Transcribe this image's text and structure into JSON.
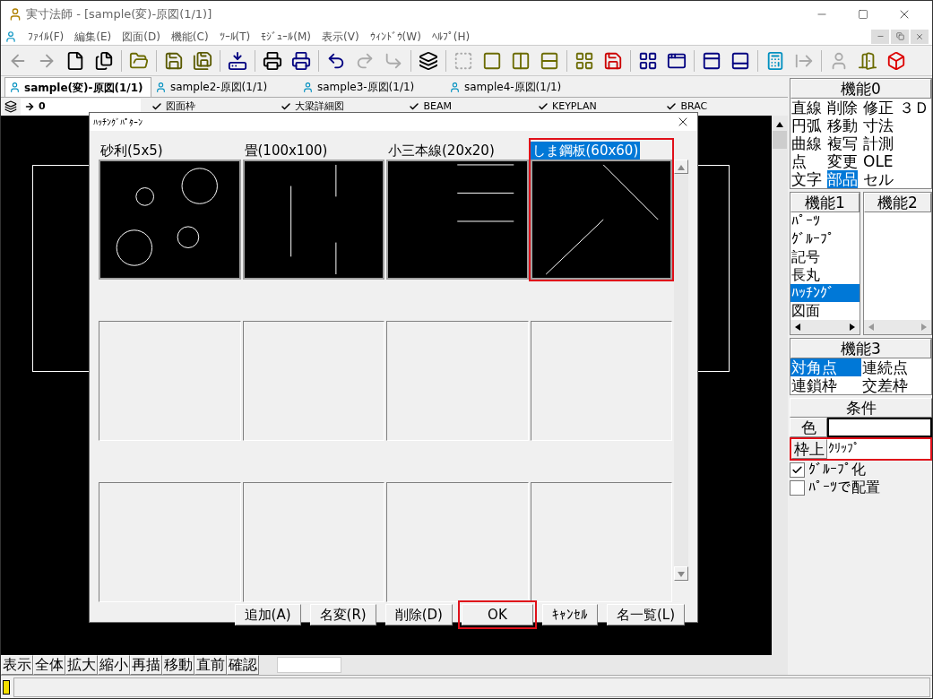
{
  "window": {
    "title": "実寸法師 - [sample(変)-原図(1/1)]"
  },
  "menu": [
    "ﾌｧｲﾙ(F)",
    "編集(E)",
    "図面(D)",
    "機能(C)",
    "ﾂｰﾙ(T)",
    "ﾓｼﾞｭｰﾙ(M)",
    "表示(V)",
    "ｳｨﾝﾄﾞｳ(W)",
    "ﾍﾙﾌﾟ(H)"
  ],
  "doc_tabs": [
    {
      "label": "sample(変)-原図(1/1)",
      "selected": true
    },
    {
      "label": "sample2-原図(1/1)",
      "selected": false
    },
    {
      "label": "sample3-原図(1/1)",
      "selected": false
    },
    {
      "label": "sample4-原図(1/1)",
      "selected": false
    }
  ],
  "layer_bar": {
    "current": "0",
    "layers": [
      {
        "label": "図面枠",
        "checked": true
      },
      {
        "label": "大梁詳細図",
        "checked": true
      },
      {
        "label": "BEAM",
        "checked": true
      },
      {
        "label": "KEYPLAN",
        "checked": true
      },
      {
        "label": "BRAC",
        "checked": true
      }
    ]
  },
  "dialog": {
    "title": "ﾊｯﾁﾝｸﾞﾊﾟﾀｰﾝ",
    "patterns": [
      {
        "kind": "circles",
        "label": "砂利(5x5)",
        "selected": false
      },
      {
        "kind": "vertical",
        "label": "畳(100x100)",
        "selected": false
      },
      {
        "kind": "horizontal",
        "label": "小三本線(20x20)",
        "selected": false
      },
      {
        "kind": "diagonal",
        "label": "しま鋼板(60x60)",
        "selected": true
      },
      {
        "kind": "empty",
        "selected": false
      },
      {
        "kind": "empty",
        "selected": false
      },
      {
        "kind": "empty",
        "selected": false
      },
      {
        "kind": "empty",
        "selected": false
      },
      {
        "kind": "empty",
        "selected": false
      },
      {
        "kind": "empty",
        "selected": false
      },
      {
        "kind": "empty",
        "selected": false
      },
      {
        "kind": "empty",
        "selected": false
      }
    ],
    "buttons": [
      {
        "label": "追加(A)",
        "highlighted": false
      },
      {
        "label": "名変(R)",
        "highlighted": false
      },
      {
        "label": "削除(D)",
        "highlighted": false
      },
      {
        "label": "OK",
        "highlighted": true
      },
      {
        "label": "ｷｬﾝｾﾙ",
        "highlighted": false
      },
      {
        "label": "名一覧(L)",
        "highlighted": false
      }
    ]
  },
  "view_buttons": [
    "表示",
    "全体",
    "拡大",
    "縮小",
    "再描",
    "移動",
    "直前",
    "確認"
  ],
  "panel": {
    "func0": {
      "title": "機能0",
      "rows": [
        [
          {
            "label": "直線",
            "selected": false
          },
          {
            "label": "削除",
            "selected": false
          },
          {
            "label": "修正",
            "selected": false
          },
          {
            "label": "３Ｄ",
            "selected": false
          }
        ],
        [
          {
            "label": "円弧",
            "selected": false
          },
          {
            "label": "移動",
            "selected": false
          },
          {
            "label": "寸法",
            "selected": false
          }
        ],
        [
          {
            "label": "曲線",
            "selected": false
          },
          {
            "label": "複写",
            "selected": false
          },
          {
            "label": "計測",
            "selected": false
          }
        ],
        [
          {
            "label": "点",
            "selected": false
          },
          {
            "label": "変更",
            "selected": false
          },
          {
            "label": "OLE",
            "selected": false
          }
        ],
        [
          {
            "label": "文字",
            "selected": false
          },
          {
            "label": "部品",
            "selected": true
          },
          {
            "label": "セル",
            "selected": false
          }
        ]
      ]
    },
    "func1": {
      "title": "機能1",
      "items": [
        {
          "label": "ﾊﾟｰﾂ",
          "selected": false
        },
        {
          "label": "ｸﾞﾙｰﾌﾟ",
          "selected": false
        },
        {
          "label": "記号",
          "selected": false
        },
        {
          "label": "長丸",
          "selected": false
        },
        {
          "label": "ﾊｯﾁﾝｸﾞ",
          "selected": true
        },
        {
          "label": "図面",
          "selected": false
        }
      ]
    },
    "func2": {
      "title": "機能2"
    },
    "func3": {
      "title": "機能3",
      "items": [
        {
          "label": "対角点",
          "selected": true
        },
        {
          "label": "連続点",
          "selected": false
        },
        {
          "label": "連鎖枠",
          "selected": false
        },
        {
          "label": "交差枠",
          "selected": false
        }
      ]
    },
    "conditions": {
      "title": "条件",
      "color_label": "色",
      "frame_label": "枠上",
      "frame_value": "ｸﾘｯﾌﾟ",
      "frame_highlighted": true,
      "options": [
        {
          "label": "ｸﾞﾙｰﾌﾟ化",
          "checked": true
        },
        {
          "label": "ﾊﾟｰﾂで配置",
          "checked": false
        }
      ]
    }
  }
}
